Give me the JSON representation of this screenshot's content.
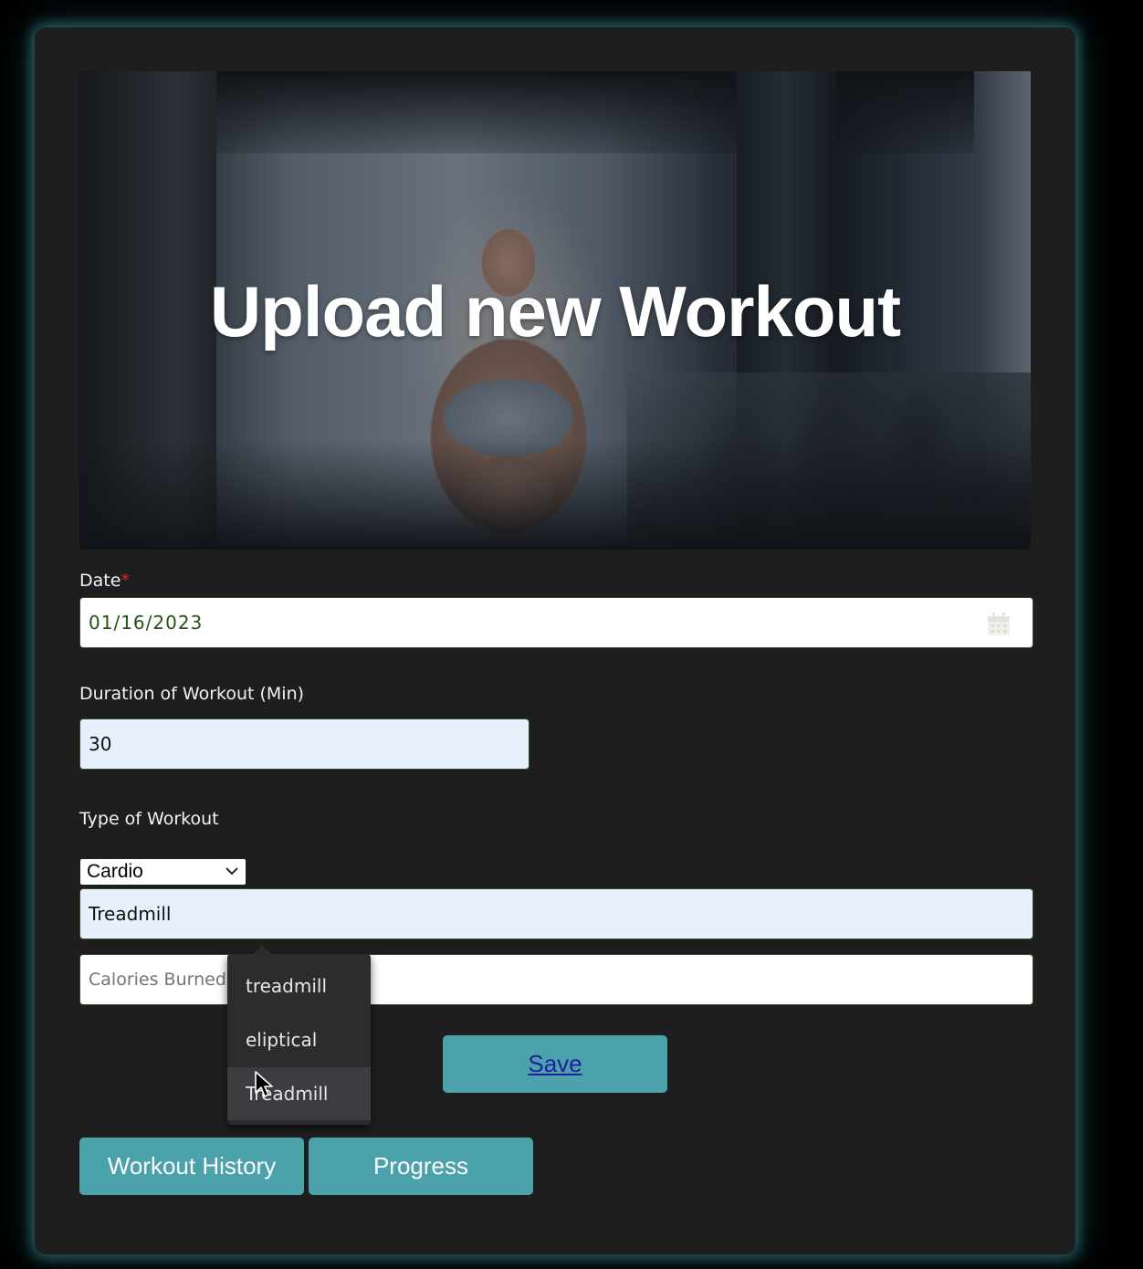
{
  "hero": {
    "title": "Upload new Workout"
  },
  "form": {
    "date": {
      "label": "Date",
      "required_mark": "*",
      "value": "01/16/2023"
    },
    "duration": {
      "label": "Duration of Workout (Min)",
      "value": "30"
    },
    "type": {
      "label": "Type of Workout",
      "selected": "Cardio"
    },
    "exercise": {
      "value": "Treadmill"
    },
    "calories": {
      "placeholder": "Calories Burned"
    }
  },
  "autocomplete": {
    "options": [
      "treadmill",
      "eliptical",
      "Treadmill"
    ],
    "highlighted_index": 2
  },
  "buttons": {
    "save": "Save",
    "history": "Workout History",
    "progress": "Progress"
  },
  "colors": {
    "card_bg": "#1f1e1f",
    "button_bg": "#4ca2aa",
    "glow": "#46a0aa",
    "save_link": "#1e1f9e",
    "required": "#d42a2a"
  },
  "icons": [
    "calendar-icon",
    "chevron-down-icon",
    "mouse-cursor-icon"
  ]
}
